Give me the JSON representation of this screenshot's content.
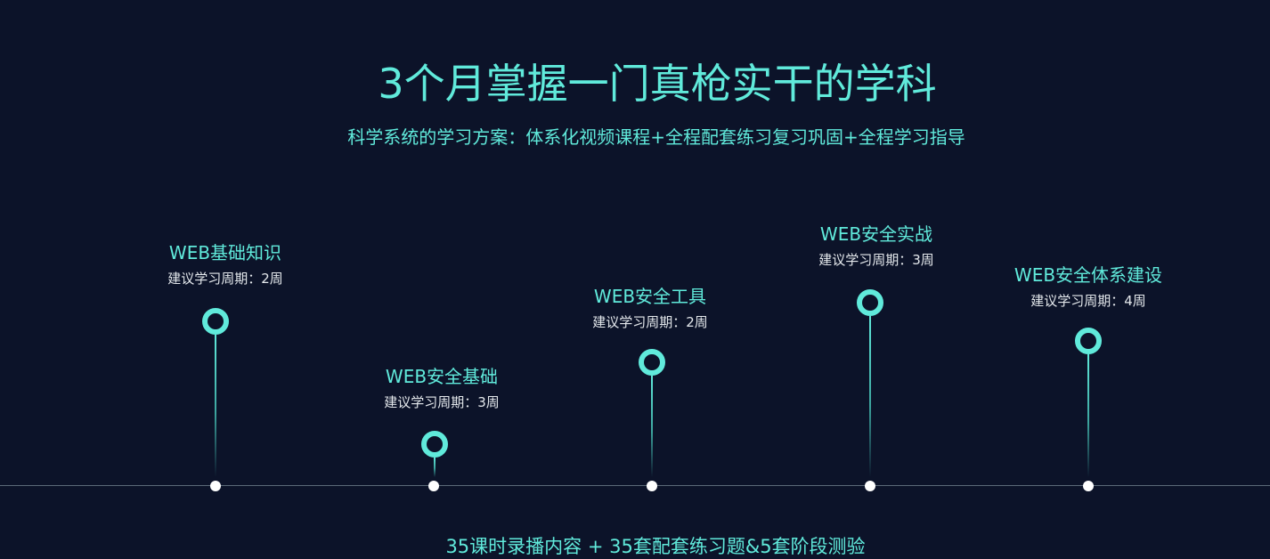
{
  "header": {
    "title": "3个月掌握一门真枪实干的学科",
    "subtitle": "科学系统的学习方案：体系化视频课程+全程配套练习复习巩固+全程学习指导"
  },
  "timeline": {
    "stages": [
      {
        "title": "WEB基础知识",
        "period": "建议学习周期：2周"
      },
      {
        "title": "WEB安全基础",
        "period": "建议学习周期：3周"
      },
      {
        "title": "WEB安全工具",
        "period": "建议学习周期：2周"
      },
      {
        "title": "WEB安全实战",
        "period": "建议学习周期：3周"
      },
      {
        "title": "WEB安全体系建设",
        "period": "建议学习周期：4周"
      }
    ]
  },
  "footer": {
    "summary": "35课时录播内容 + 35套配套练习题&5套阶段测验"
  },
  "colors": {
    "background": "#0c1329",
    "accent": "#60eadb",
    "period_text": "#e4e8ec",
    "marker_dot": "#ffffff"
  }
}
